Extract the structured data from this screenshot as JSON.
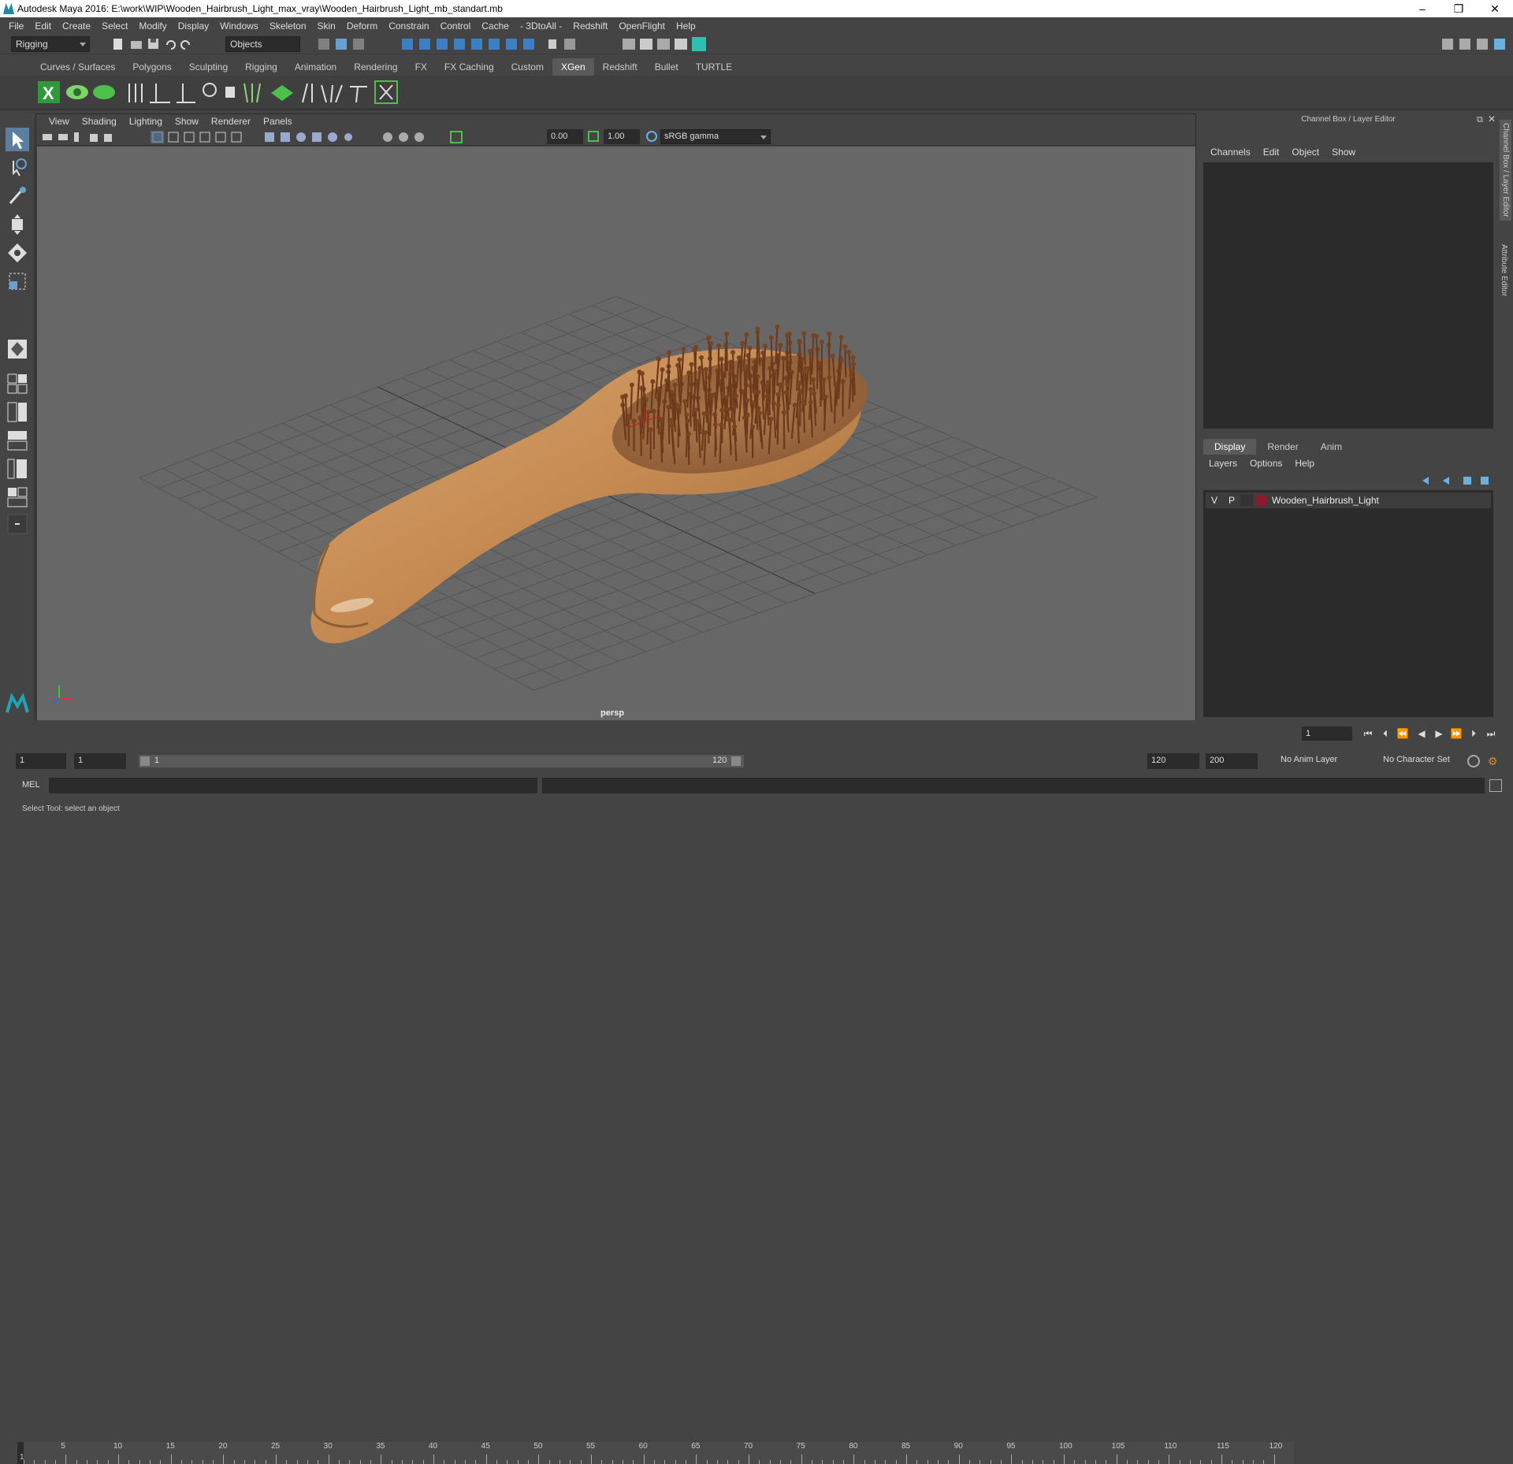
{
  "window": {
    "title": "Autodesk Maya 2016: E:\\work\\WIP\\Wooden_Hairbrush_Light_max_vray\\Wooden_Hairbrush_Light_mb_standart.mb",
    "minimize": "–",
    "restore": "❐",
    "close": "✕"
  },
  "menubar": [
    "File",
    "Edit",
    "Create",
    "Select",
    "Modify",
    "Display",
    "Windows",
    "Skeleton",
    "Skin",
    "Deform",
    "Constrain",
    "Control",
    "Cache",
    "- 3DtoAll -",
    "Redshift",
    "OpenFlight",
    "Help"
  ],
  "statusline": {
    "mode": "Rigging",
    "selection_mode": "Objects"
  },
  "shelf_tabs": [
    "Curves / Surfaces",
    "Polygons",
    "Sculpting",
    "Rigging",
    "Animation",
    "Rendering",
    "FX",
    "FX Caching",
    "Custom",
    "XGen",
    "Redshift",
    "Bullet",
    "TURTLE"
  ],
  "active_shelf_tab": "XGen",
  "viewport": {
    "menu": [
      "View",
      "Shading",
      "Lighting",
      "Show",
      "Renderer",
      "Panels"
    ],
    "exposure": "0.00",
    "gamma": "1.00",
    "color_space": "sRGB gamma",
    "camera_label": "persp"
  },
  "channel_box": {
    "title": "Channel Box / Layer Editor",
    "menu": [
      "Channels",
      "Edit",
      "Object",
      "Show"
    ],
    "layer_tabs": [
      "Display",
      "Render",
      "Anim"
    ],
    "active_layer_tab": "Display",
    "layer_menu": [
      "Layers",
      "Options",
      "Help"
    ],
    "layers": [
      {
        "v": "V",
        "p": "P",
        "color": "#8c1a2e",
        "name": "Wooden_Hairbrush_Light"
      }
    ]
  },
  "side_tabs": [
    "Channel Box / Layer Editor",
    "Attribute Editor"
  ],
  "timeline": {
    "ticks": [
      "5",
      "10",
      "15",
      "20",
      "25",
      "30",
      "35",
      "40",
      "45",
      "50",
      "55",
      "60",
      "65",
      "70",
      "75",
      "80",
      "85",
      "90",
      "95",
      "100",
      "105",
      "110",
      "115",
      "120"
    ],
    "first_label": "1",
    "current_frame": "1"
  },
  "range": {
    "start": "1",
    "playback_start": "1",
    "slider_start": "1",
    "slider_end": "120",
    "playback_end": "120",
    "end": "200",
    "anim_layer": "No Anim Layer",
    "character_set": "No Character Set"
  },
  "command_line": {
    "label": "MEL"
  },
  "help_line": "Select Tool: select an object"
}
